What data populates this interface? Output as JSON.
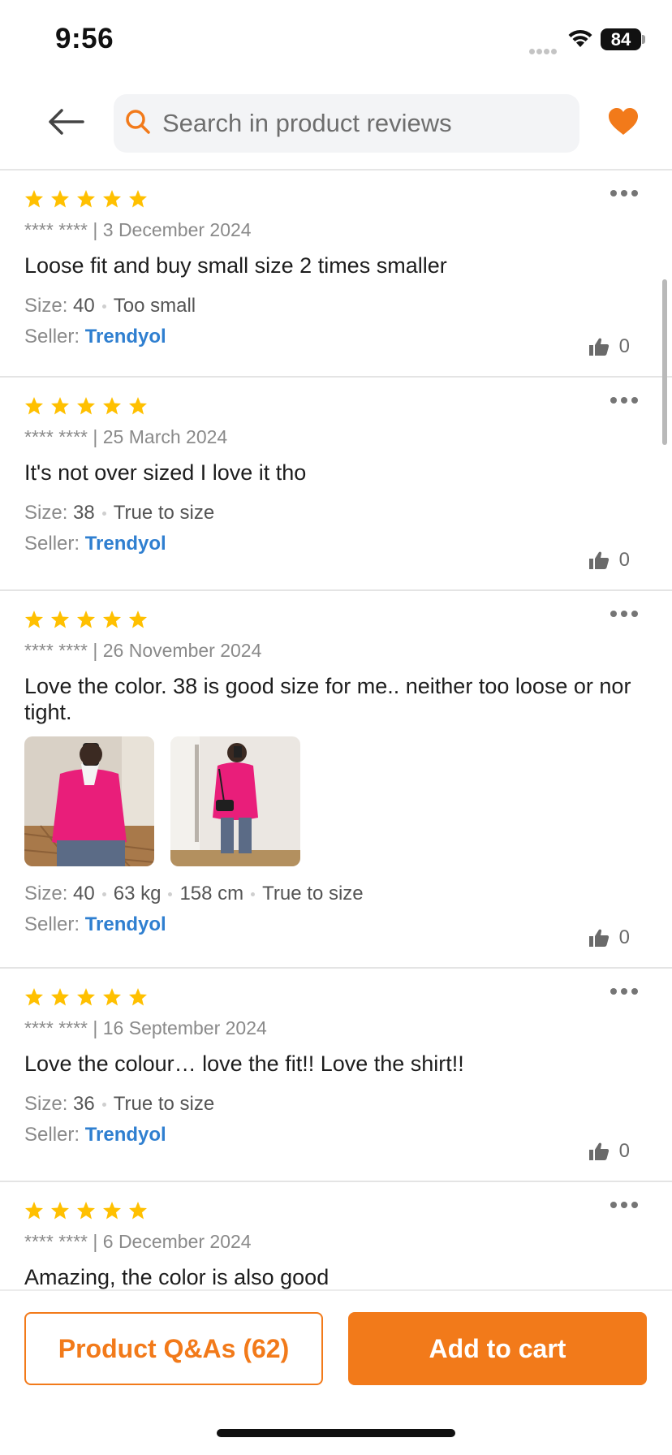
{
  "status_bar": {
    "time": "9:56",
    "battery": "84"
  },
  "header": {
    "search_placeholder": "Search in product reviews"
  },
  "colors": {
    "accent": "#f27a1a",
    "star": "#ffc000",
    "seller_link": "#2f7fd0"
  },
  "labels": {
    "size": "Size:",
    "seller": "Seller:"
  },
  "reviews": [
    {
      "rating": 5,
      "author": "**** ****",
      "date": "3 December 2024",
      "text": "Loose fit and buy small size 2 times smaller",
      "size": "40",
      "weight": "",
      "height": "",
      "fit": "Too small",
      "seller": "Trendyol",
      "likes": "0"
    },
    {
      "rating": 5,
      "author": "**** ****",
      "date": "25 March 2024",
      "text": "It's not over sized I love it tho",
      "size": "38",
      "weight": "",
      "height": "",
      "fit": "True to size",
      "seller": "Trendyol",
      "likes": "0"
    },
    {
      "rating": 5,
      "author": "**** ****",
      "date": "26 November 2024",
      "text": "Love the color. 38 is good size for me.. neither too loose or nor tight.",
      "size": "40",
      "weight": "63 kg",
      "height": "158 cm",
      "fit": "True to size",
      "seller": "Trendyol",
      "likes": "0"
    },
    {
      "rating": 5,
      "author": "**** ****",
      "date": "16 September 2024",
      "text": "Love the colour… love the fit!! Love the shirt!!",
      "size": "36",
      "weight": "",
      "height": "",
      "fit": "True to size",
      "seller": "Trendyol",
      "likes": "0"
    },
    {
      "rating": 5,
      "author": "**** ****",
      "date": "6 December 2024",
      "text": "Amazing, the color is also good"
    }
  ],
  "footer": {
    "qa_button": "Product Q&As (62)",
    "cart_button": "Add to cart"
  }
}
